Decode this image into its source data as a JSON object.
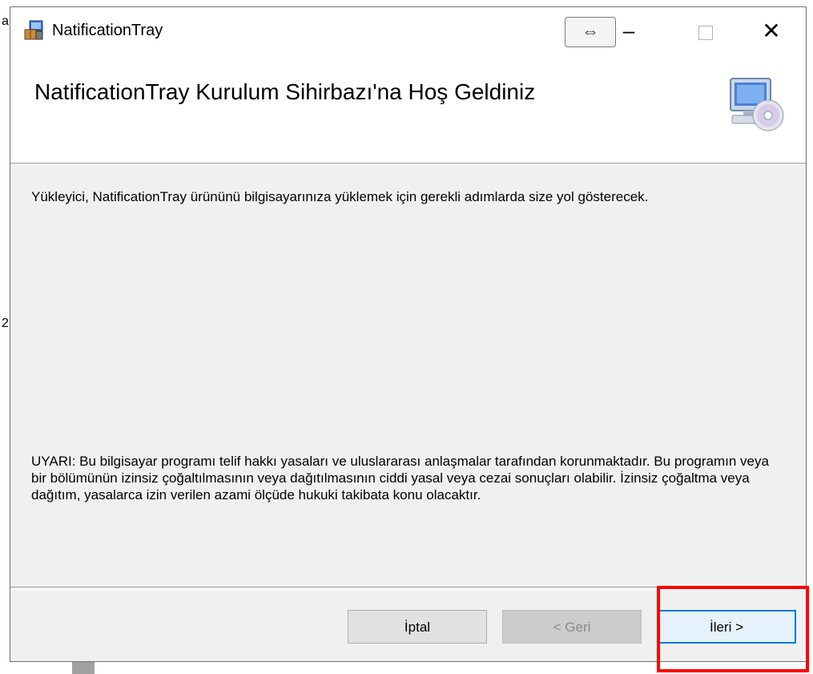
{
  "background_fragments": {
    "top": "a",
    "mid": "2("
  },
  "window": {
    "title": "NatificationTray",
    "controls": {
      "restore_arrows": "⇔",
      "minimize": "–",
      "close": "✕"
    }
  },
  "header": {
    "title": "NatificationTray Kurulum Sihirbazı'na Hoş Geldiniz",
    "icon": "setup-computer-cd-icon"
  },
  "body": {
    "welcome_text": "Yükleyici, NatificationTray ürününü bilgisayarınıza yüklemek için gerekli adımlarda size yol gösterecek.",
    "warning_text": "UYARI: Bu bilgisayar programı telif hakkı yasaları ve uluslararası anlaşmalar tarafından korunmaktadır. Bu programın veya bir bölümünün izinsiz çoğaltılmasının veya dağıtılmasının ciddi yasal veya cezai sonuçları olabilir. İzinsiz çoğaltma veya dağıtım, yasalarca izin verilen azami ölçüde hukuki takibata konu olacaktır."
  },
  "buttons": {
    "cancel": "İptal",
    "back": "< Geri",
    "next": "İleri >"
  },
  "colors": {
    "highlight": "#ff0000",
    "focus_border": "#0078d7",
    "dialog_bg": "#f0f0f0"
  }
}
